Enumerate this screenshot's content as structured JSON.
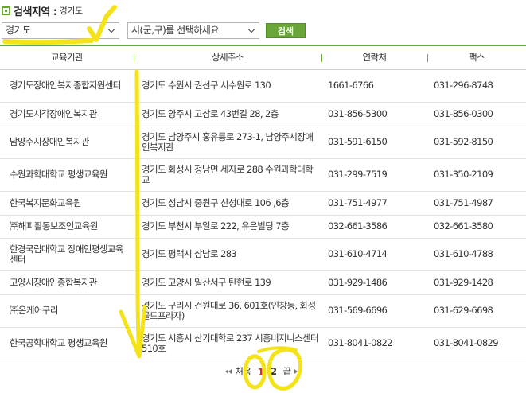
{
  "header": {
    "title": "검색지역 :",
    "region": "경기도"
  },
  "filters": {
    "province": "경기도",
    "city": "시(군,구)를 선택하세요",
    "search_label": "검색"
  },
  "table": {
    "columns": [
      "교육기관",
      "상세주소",
      "연락처",
      "팩스"
    ],
    "rows": [
      [
        "경기도장애인복지종합지원센터",
        "경기도 수원시 권선구 서수원로 130",
        "1661-6766",
        "031-296-8748"
      ],
      [
        "경기도시각장애인복지관",
        "경기도 양주시 고삼로 43번길 28, 2층",
        "031-856-5300",
        "031-856-0300"
      ],
      [
        "남양주시장애인복지관",
        "경기도 남양주시 홍유릉로 273-1, 남양주시장애인복지관",
        "031-591-6150",
        "031-592-8150"
      ],
      [
        "수원과학대학교 평생교육원",
        "경기도 화성시 정남면 세자로 288 수원과학대학교",
        "031-299-7519",
        "031-350-2109"
      ],
      [
        "한국복지문화교육원",
        "경기도 성남시 중원구 산성대로 106 ,6층",
        "031-751-4977",
        "031-751-4987"
      ],
      [
        "㈜해피활동보조인교육원",
        "경기도 부천시 부일로 222, 유은빌딩 7층",
        "032-661-3586",
        "032-661-3580"
      ],
      [
        "한경국립대학교 장애인평생교육센터",
        "경기도 평택시 삼남로 283",
        "031-610-4714",
        "031-610-4788"
      ],
      [
        "고양시장애인종합복지관",
        "경기도 고양시 일산서구 탄현로 139",
        "031-929-1486",
        "031-929-1428"
      ],
      [
        "㈜온케어구리",
        "경기도 구리시 건원대로 36, 601호(인창동, 화성골드프라자)",
        "031-569-6696",
        "031-629-6698"
      ],
      [
        "한국공학대학교 평생교육원",
        "경기도 시흥시 산기대학로 237 시흥비지니스센터 510호",
        "031-8041-0822",
        "031-8041-0829"
      ]
    ]
  },
  "pagination": {
    "first": "처음",
    "current": "1",
    "next_page": "2",
    "last": "끝"
  },
  "colors": {
    "accent": "#6aa53a",
    "current_page": "#d0302b",
    "annotation": "#f5e31a"
  }
}
